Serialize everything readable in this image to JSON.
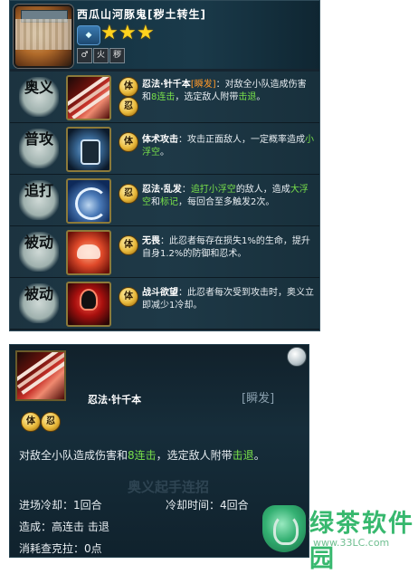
{
  "character": {
    "name": "西瓜山河豚鬼[秽土转生]",
    "stars": 3,
    "attributes": [
      "♂",
      "火",
      "秽"
    ]
  },
  "skills": [
    {
      "category": "奥义",
      "icon": "needle-hair-icon",
      "badges": [
        "体",
        "忍"
      ],
      "name": "忍法·针千本",
      "tag": "[瞬发]",
      "text_a": "：对敌全小队造成伤害和",
      "hl_a": "8连击",
      "text_b": "，选定敌人附带",
      "hl_b": "击退",
      "text_c": "。"
    },
    {
      "category": "普攻",
      "icon": "fist-icon",
      "badges": [
        "体"
      ],
      "name": "体术攻击",
      "text_a": "：攻击正面敌人，一定概率造成",
      "hl_a": "小浮空",
      "text_b": "。"
    },
    {
      "category": "追打",
      "icon": "swirling-hair-icon",
      "badges": [
        "忍"
      ],
      "name": "忍法·乱发",
      "text_a": "：",
      "hl_a": "追打小浮空",
      "text_b": "的敌人，造成",
      "hl_b": "大浮空",
      "text_c": "和",
      "hl_c": "标记",
      "text_d": "，每回合至多触发2次。"
    },
    {
      "category": "被动",
      "icon": "muscle-icon",
      "badges": [
        "体"
      ],
      "name": "无畏",
      "text_a": "：此忍者每存在损失1%的生命，提升自身1.2%的防御和忍术。"
    },
    {
      "category": "被动",
      "icon": "rage-icon",
      "badges": [
        "体"
      ],
      "name": "战斗欲望",
      "text_a": "：此忍者每次受到攻击时，奥义立即减少1冷却。"
    }
  ],
  "detail": {
    "name": "忍法·针千本",
    "type": "[瞬发]",
    "badges": [
      "体",
      "忍"
    ],
    "desc_a": "对敌全小队造成伤害和",
    "desc_hl_a": "8连击",
    "desc_b": "，选定敌人附带",
    "desc_hl_b": "击退",
    "desc_c": "。",
    "entry_cd": "进场冷却：1回合",
    "cooldown": "冷却时间：4回合",
    "causes": "造成：高连击 击退",
    "chakra": "消耗查克拉：0点",
    "ghost_label": "奥义起手连招"
  },
  "watermark": {
    "text": "绿茶软件园",
    "url": "www.33LC.com"
  },
  "colors": {
    "highlight_orange": "#ff9a2a",
    "highlight_green": "#78e04a",
    "star": "#ffd21e"
  }
}
